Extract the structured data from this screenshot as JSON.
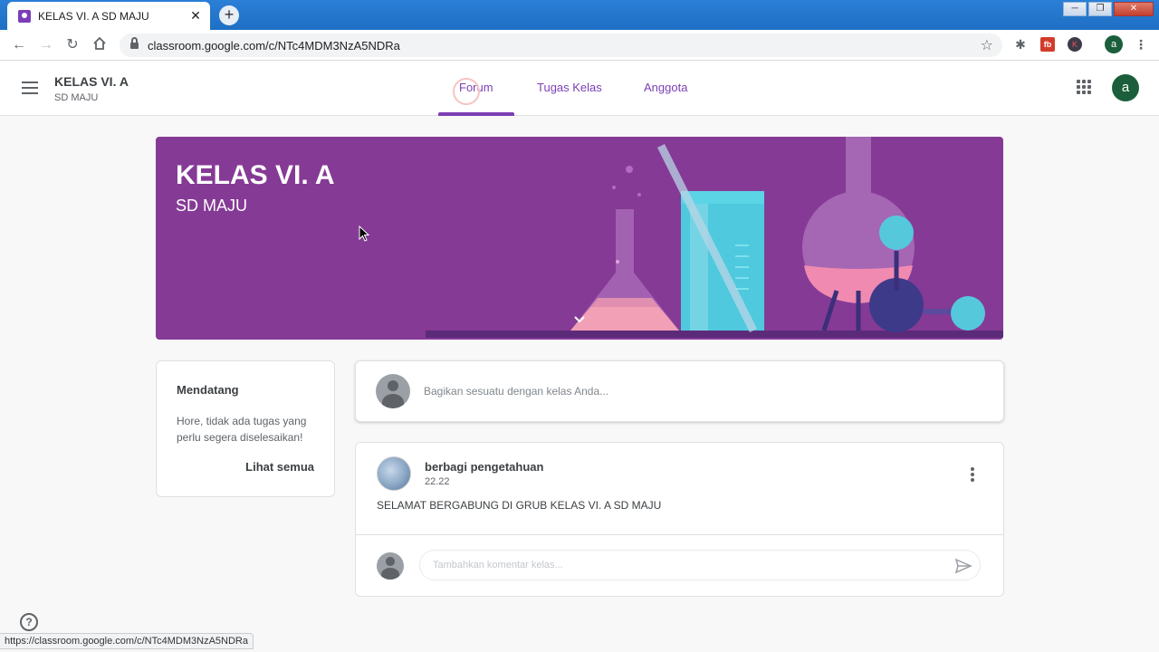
{
  "browser": {
    "tab_title": "KELAS VI. A SD MAJU",
    "url": "classroom.google.com/c/NTc4MDM3NzA5NDRa",
    "status_url": "https://classroom.google.com/c/NTc4MDM3NzA5NDRa",
    "profile_letter": "a"
  },
  "header": {
    "class_name": "KELAS VI. A",
    "school_name": "SD MAJU",
    "tabs": [
      {
        "label": "Forum",
        "active": true
      },
      {
        "label": "Tugas Kelas",
        "active": false
      },
      {
        "label": "Anggota",
        "active": false
      }
    ],
    "avatar_letter": "a"
  },
  "banner": {
    "title": "KELAS VI. A",
    "subtitle": "SD MAJU"
  },
  "upcoming": {
    "title": "Mendatang",
    "message": "Hore, tidak ada tugas yang perlu segera diselesaikan!",
    "see_all": "Lihat semua"
  },
  "share": {
    "placeholder": "Bagikan sesuatu dengan kelas Anda..."
  },
  "post": {
    "author": "berbagi pengetahuan",
    "time": "22.22",
    "body": "SELAMAT BERGABUNG DI GRUB KELAS VI. A SD MAJU",
    "comment_placeholder": "Tambahkan komentar kelas..."
  },
  "colors": {
    "accent": "#7b3fb5",
    "banner": "#853a95",
    "avatar": "#1b5e3b"
  }
}
